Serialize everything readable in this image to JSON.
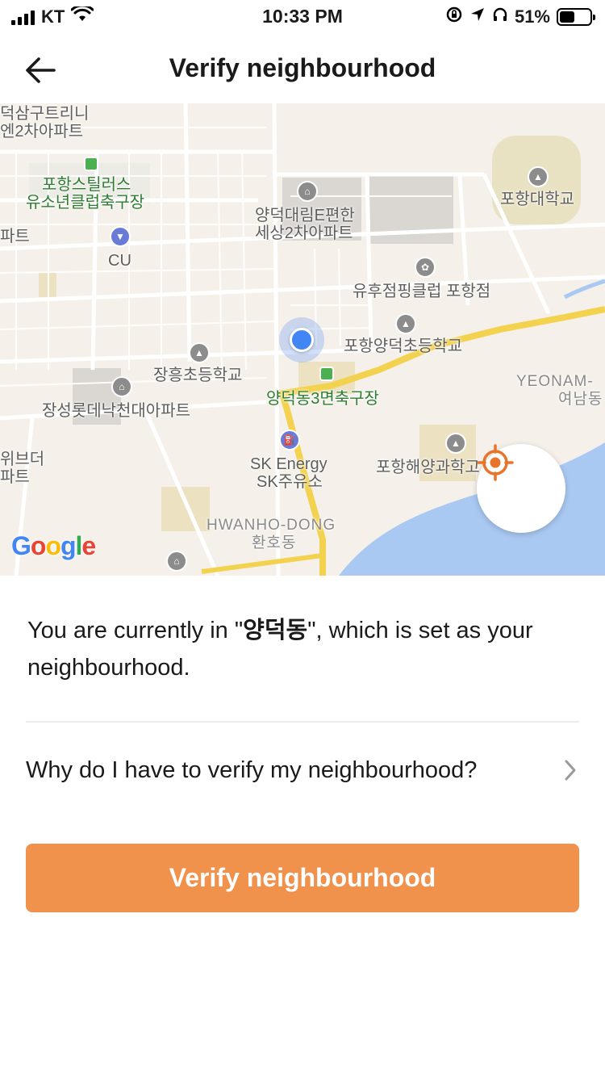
{
  "status_bar": {
    "carrier": "KT",
    "time": "10:33 PM",
    "battery_percent": "51%",
    "battery_level": 0.51
  },
  "nav": {
    "title": "Verify neighbourhood",
    "back_icon": "arrow-left-icon"
  },
  "map": {
    "labels": {
      "l1": "덕삼구트리니",
      "l2": "엔2차아파트",
      "l3": "포항스틸러스",
      "l4": "유소년클럽축구장",
      "l5": "파트",
      "l6": "CU",
      "l7": "양덕대림E편한",
      "l8": "세상2차아파트",
      "l9": "포항대학교",
      "l10": "유후점핑클럽 포항점",
      "l11": "포항양덕초등학교",
      "l12": "장흥초등학교",
      "l13": "양덕동3면축구장",
      "l14": "장성롯데낙천대아파트",
      "l15": "YEONAM-",
      "l16": "여남동",
      "l17": "위브더",
      "l18": "파트",
      "l19": "SK Energy",
      "l20": "SK주유소",
      "l21": "포항해양과학고",
      "l22": "HWANHO-DONG",
      "l23": "환호동"
    },
    "logo": [
      "G",
      "o",
      "o",
      "g",
      "l",
      "e"
    ],
    "logo_colors": [
      "#4285f4",
      "#ea4335",
      "#fbbc05",
      "#4285f4",
      "#34a853",
      "#ea4335"
    ],
    "recenter_icon": "crosshair-target-icon",
    "accent": "#e8742c"
  },
  "content": {
    "info_prefix": "You are currently in \"",
    "info_place": "양덕동",
    "info_suffix": "\", which is set as your neighbourhood.",
    "why_label": "Why do I have to verify my neighbourhood?",
    "verify_button": "Verify neighbourhood",
    "button_color": "#f0914c"
  }
}
